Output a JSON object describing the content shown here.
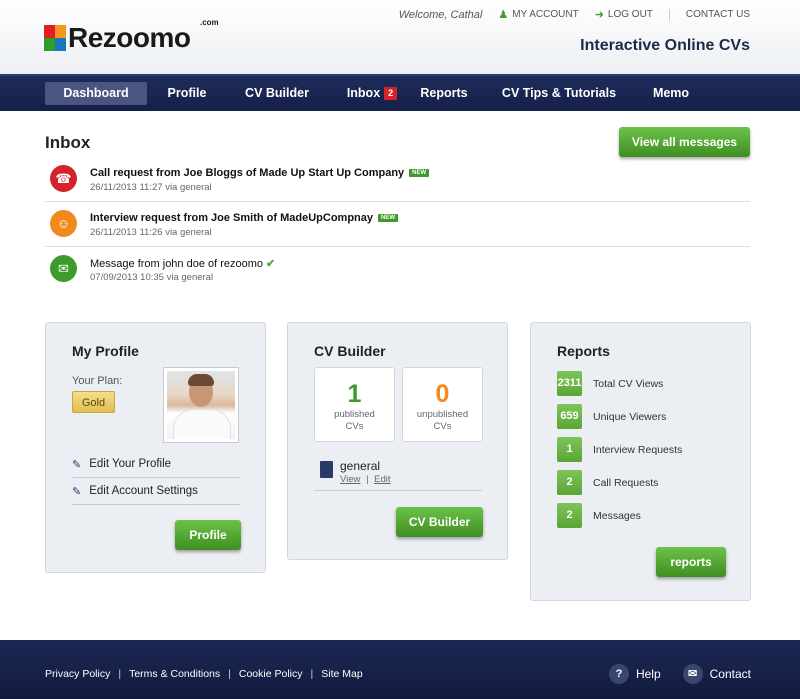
{
  "header": {
    "logo_text": "Rezoomo",
    "logo_suffix": ".com",
    "tagline": "Interactive Online CVs",
    "welcome": "Welcome, Cathal",
    "my_account": "MY ACCOUNT",
    "logout": "LOG OUT",
    "contact": "CONTACT US"
  },
  "nav": {
    "items": [
      {
        "label": "Dashboard",
        "active": true
      },
      {
        "label": "Profile"
      },
      {
        "label": "CV Builder"
      },
      {
        "label": "Inbox",
        "badge": "2"
      },
      {
        "label": "Reports"
      },
      {
        "label": "CV Tips & Tutorials"
      },
      {
        "label": "Memo"
      }
    ]
  },
  "inbox": {
    "title": "Inbox",
    "view_all": "View all messages",
    "messages": [
      {
        "subject": "Call request from Joe Bloggs of Made Up Start Up Company",
        "meta": "26/11/2013 11:27 via general",
        "tag": "NEW",
        "icon": "phone-icon",
        "color": "#d4232b"
      },
      {
        "subject": "Interview request from Joe Smith of MadeUpCompnay",
        "meta": "26/11/2013 11:26 via general",
        "tag": "NEW",
        "icon": "people-icon",
        "color": "#f08a1d"
      },
      {
        "subject": "Message from john doe of rezoomo",
        "meta": "07/09/2013 10:35 via general",
        "icon": "envelope-icon",
        "color": "#3e9a2a"
      }
    ]
  },
  "my_profile": {
    "title": "My Profile",
    "plan_label": "Your Plan:",
    "plan": "Gold",
    "links": [
      "Edit Your Profile",
      "Edit Account Settings"
    ],
    "button": "Profile"
  },
  "cv_builder": {
    "title": "CV Builder",
    "published_count": "1",
    "published_label": [
      "published",
      "CVs"
    ],
    "unpublished_count": "0",
    "unpublished_label": [
      "unpublished",
      "CVs"
    ],
    "cv_name": "general",
    "view": "View",
    "edit": "Edit",
    "separator": "|",
    "button": "CV Builder",
    "published_color": "#3e9a2a",
    "unpublished_color": "#f08a1d"
  },
  "reports": {
    "title": "Reports",
    "rows": [
      {
        "value": "2311",
        "label": "Total CV Views"
      },
      {
        "value": "659",
        "label": "Unique Viewers"
      },
      {
        "value": "1",
        "label": "Interview Requests"
      },
      {
        "value": "2",
        "label": "Call Requests"
      },
      {
        "value": "2",
        "label": "Messages"
      }
    ],
    "button": "reports"
  },
  "footer": {
    "links": [
      "Privacy Policy",
      "Terms & Conditions",
      "Cookie Policy",
      "Site Map"
    ],
    "separator": "|",
    "help": "Help",
    "contact": "Contact"
  }
}
